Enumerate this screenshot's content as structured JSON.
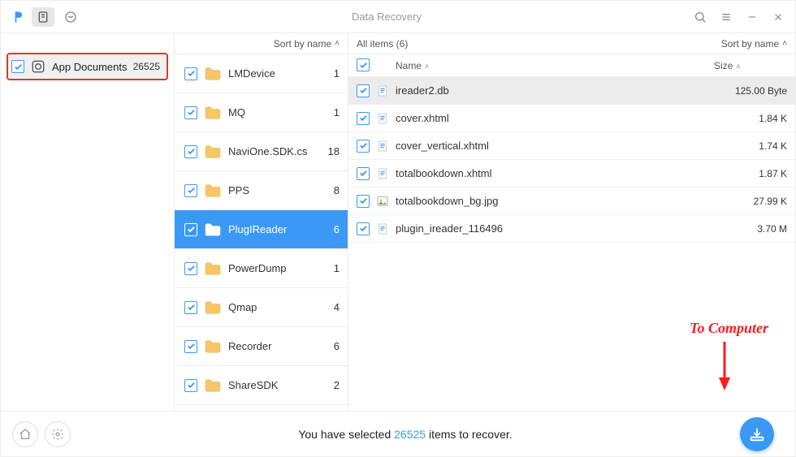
{
  "titlebar": {
    "title": "Data Recovery"
  },
  "sidebar": {
    "items": [
      {
        "label": "App Documents",
        "count": "26525"
      }
    ]
  },
  "folder_pane": {
    "sort_label": "Sort by name",
    "folders": [
      {
        "name": "LMDevice",
        "count": "1",
        "selected": false
      },
      {
        "name": "MQ",
        "count": "1",
        "selected": false
      },
      {
        "name": "NaviOne.SDK.cs",
        "count": "18",
        "selected": false
      },
      {
        "name": "PPS",
        "count": "8",
        "selected": false
      },
      {
        "name": "PlugIReader",
        "count": "6",
        "selected": true
      },
      {
        "name": "PowerDump",
        "count": "1",
        "selected": false
      },
      {
        "name": "Qmap",
        "count": "4",
        "selected": false
      },
      {
        "name": "Recorder",
        "count": "6",
        "selected": false
      },
      {
        "name": "ShareSDK",
        "count": "2",
        "selected": false
      }
    ]
  },
  "file_pane": {
    "header_left": "All items (6)",
    "header_sort": "Sort by name",
    "col_name": "Name",
    "col_size": "Size",
    "files": [
      {
        "name": "ireader2.db",
        "size": "125.00 Byte",
        "icon": "doc",
        "selected": true
      },
      {
        "name": "cover.xhtml",
        "size": "1.84 K",
        "icon": "doc",
        "selected": false
      },
      {
        "name": "cover_vertical.xhtml",
        "size": "1.74 K",
        "icon": "doc",
        "selected": false
      },
      {
        "name": "totalbookdown.xhtml",
        "size": "1.87 K",
        "icon": "doc",
        "selected": false
      },
      {
        "name": "totalbookdown_bg.jpg",
        "size": "27.99 K",
        "icon": "img",
        "selected": false
      },
      {
        "name": "plugin_ireader_116496",
        "size": "3.70 M",
        "icon": "doc",
        "selected": false
      }
    ]
  },
  "footer": {
    "text_prefix": "You have selected ",
    "count": "26525",
    "text_suffix": " items to recover."
  },
  "annotation": {
    "label": "To Computer"
  },
  "colors": {
    "accent": "#3b99f5",
    "highlight_red": "#d63a2f"
  }
}
